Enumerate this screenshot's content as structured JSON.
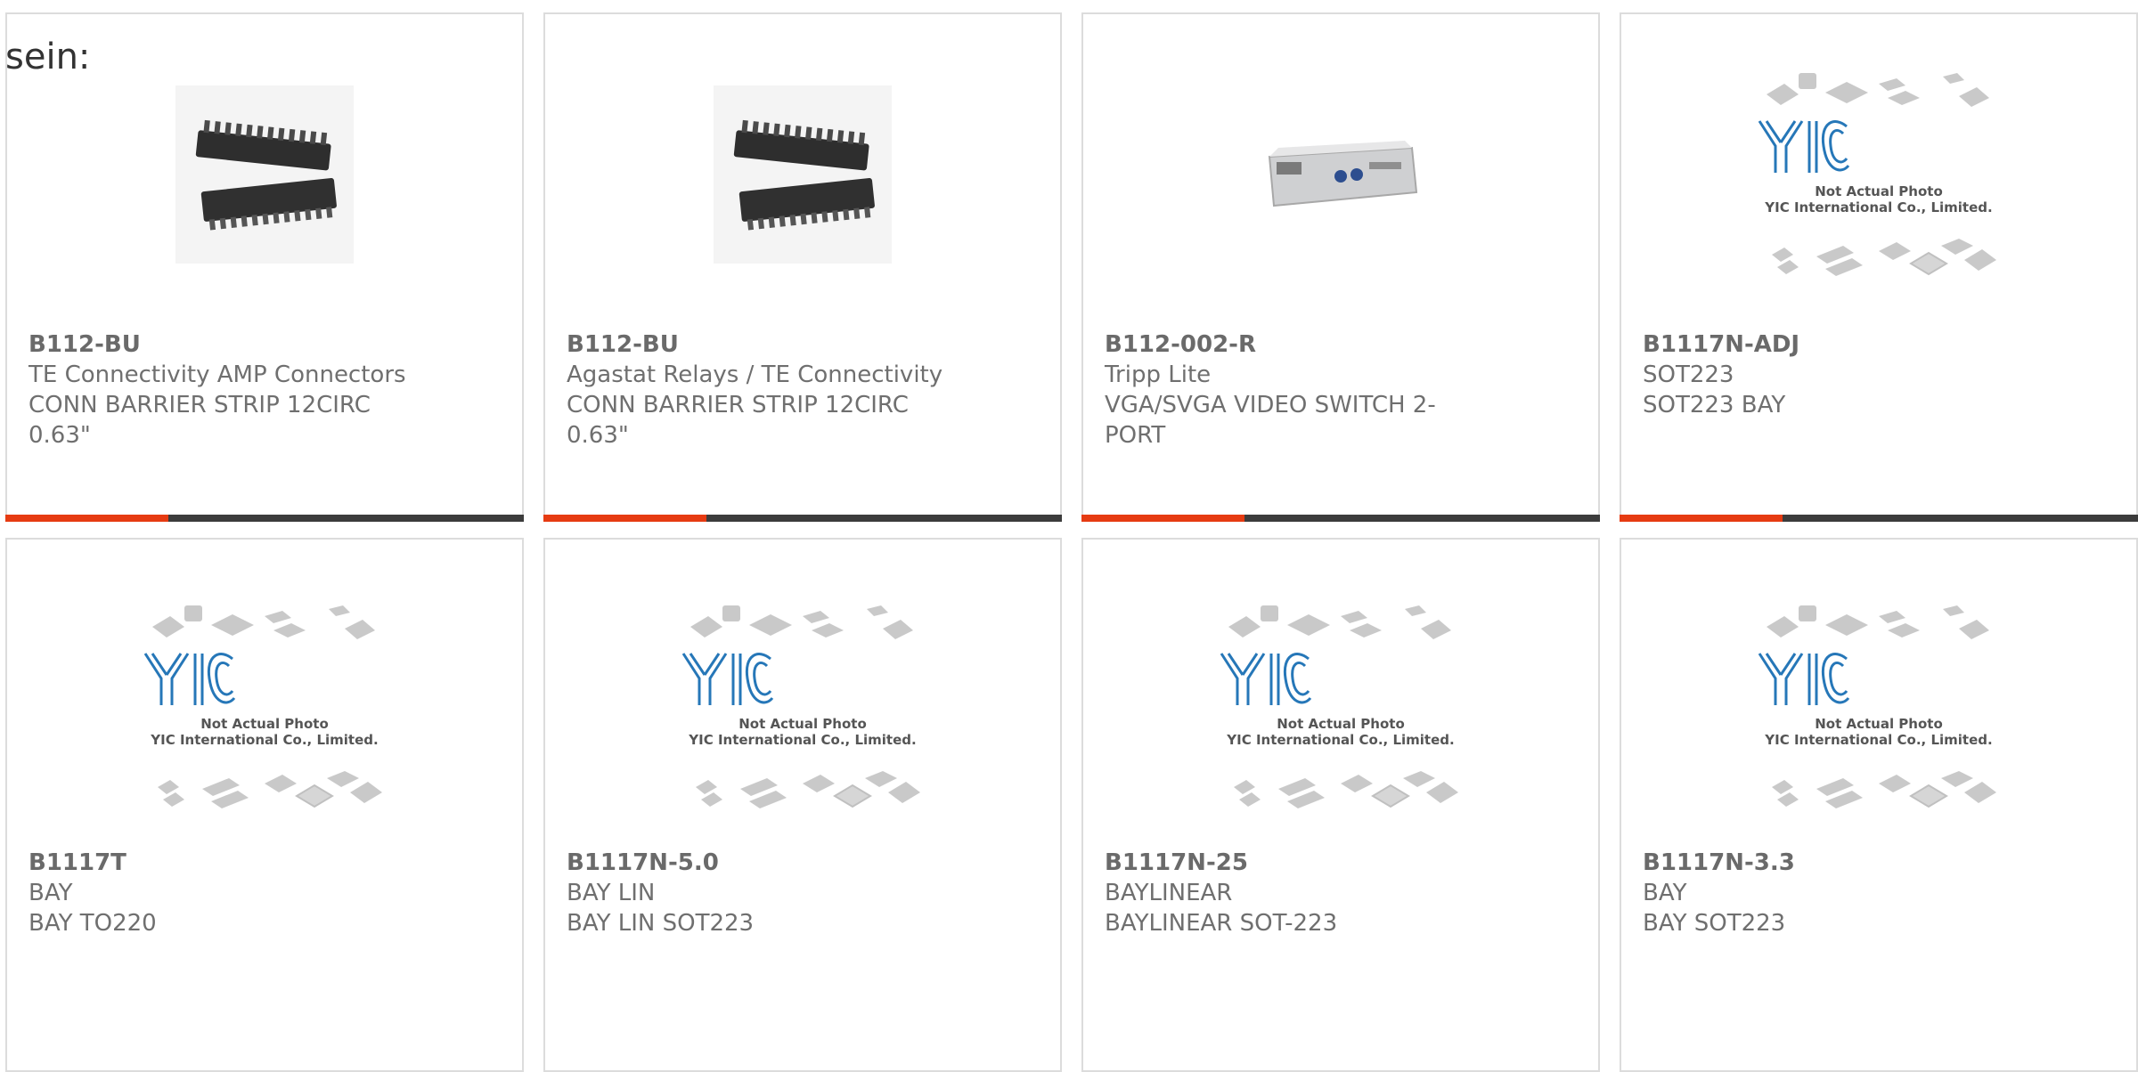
{
  "fragment_text": "sein:",
  "placeholder": {
    "caption_line1": "Not Actual Photo",
    "caption_line2": "YIC International Co., Limited.",
    "logo_text": "YIC"
  },
  "colors": {
    "accent": "#e63b12",
    "bar_dark": "#3c3c3c",
    "card_border": "#dcdcdc",
    "text": "#6f6f6f",
    "logo_blue": "#2677b8"
  },
  "products": [
    {
      "part_number": "B112-BU",
      "manufacturer": "TE Connectivity AMP Connectors",
      "description": "CONN BARRIER STRIP 12CIRC 0.63\"",
      "description_lines": [
        "CONN BARRIER STRIP 12CIRC",
        "0.63\""
      ],
      "image": "barrier-strip",
      "accent_bar": true
    },
    {
      "part_number": "B112-BU",
      "manufacturer": "Agastat Relays / TE Connectivity",
      "description": "CONN BARRIER STRIP 12CIRC 0.63\"",
      "description_lines": [
        "CONN BARRIER STRIP 12CIRC",
        "0.63\""
      ],
      "image": "barrier-strip",
      "accent_bar": true
    },
    {
      "part_number": "B112-002-R",
      "manufacturer": "Tripp Lite",
      "description": "VGA/SVGA VIDEO SWITCH 2-PORT",
      "description_lines": [
        "VGA/SVGA VIDEO SWITCH 2-",
        "PORT"
      ],
      "image": "vga-switch",
      "accent_bar": true
    },
    {
      "part_number": "B1117N-ADJ",
      "manufacturer": "SOT223",
      "description": "SOT223 BAY",
      "description_lines": [
        "SOT223 BAY"
      ],
      "image": "placeholder",
      "accent_bar": true
    },
    {
      "part_number": "B1117T",
      "manufacturer": "BAY",
      "description": "BAY TO220",
      "description_lines": [
        "BAY TO220"
      ],
      "image": "placeholder",
      "accent_bar": false
    },
    {
      "part_number": "B1117N-5.0",
      "manufacturer": "BAY LIN",
      "description": "BAY LIN SOT223",
      "description_lines": [
        "BAY LIN SOT223"
      ],
      "image": "placeholder",
      "accent_bar": false
    },
    {
      "part_number": "B1117N-25",
      "manufacturer": "BAYLINEAR",
      "description": "BAYLINEAR SOT-223",
      "description_lines": [
        "BAYLINEAR SOT-223"
      ],
      "image": "placeholder",
      "accent_bar": false
    },
    {
      "part_number": "B1117N-3.3",
      "manufacturer": "BAY",
      "description": "BAY SOT223",
      "description_lines": [
        "BAY SOT223"
      ],
      "image": "placeholder",
      "accent_bar": false
    }
  ]
}
